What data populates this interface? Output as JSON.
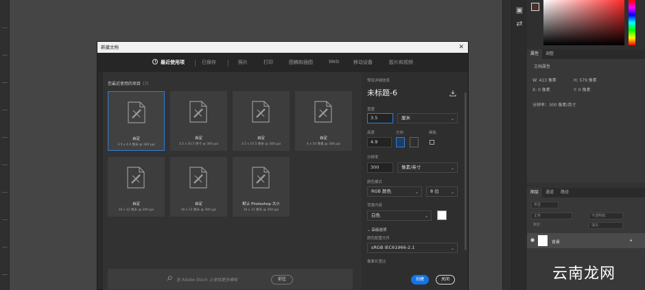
{
  "dialog": {
    "title": "新建文档",
    "tabs": [
      {
        "label": "最近使用项",
        "active": true
      },
      {
        "label": "已保存"
      },
      {
        "label": "照片"
      },
      {
        "label": "打印"
      },
      {
        "label": "图稿和插图"
      },
      {
        "label": "Web"
      },
      {
        "label": "移动设备"
      },
      {
        "label": "胶片和视频"
      }
    ],
    "recent": {
      "heading": "您最近使用的项目",
      "count": "(7)",
      "items": [
        {
          "name": "自定",
          "size": "3.5 x 4.9 厘米 @ 300 ppi"
        },
        {
          "name": "自定",
          "size": "3.5 x 10.5 英寸 @ 300 ppi"
        },
        {
          "name": "自定",
          "size": "3.5 x 10.5 厘米 @ 300 ppi"
        },
        {
          "name": "自定",
          "size": "4 x 10 像素 @ 300 ppi"
        },
        {
          "name": "自定",
          "size": "16 x 12 厘米 @ 300 ppi"
        },
        {
          "name": "自定",
          "size": "16 x 12 厘米 @ 300 ppi"
        },
        {
          "name": "默认 Photoshop 大小",
          "size": "16 x 12 厘米 @ 300 ppi"
        }
      ]
    },
    "search": {
      "placeholder": "在 Adobe Stock 上查找更多模板",
      "go": "前往"
    },
    "details": {
      "section": "预设详细信息",
      "doc_name": "未标题-6",
      "width_label": "宽度",
      "width_value": "3.5",
      "width_unit": "厘米",
      "height_label": "高度",
      "height_value": "4.9",
      "orientation_label": "方向",
      "artboard_label": "画板",
      "resolution_label": "分辨率",
      "resolution_value": "300",
      "resolution_unit": "像素/英寸",
      "color_mode_label": "颜色模式",
      "color_mode_value": "RGB 颜色",
      "bit_depth": "8 位",
      "bg_label": "背景内容",
      "bg_value": "白色",
      "advanced_label": "高级选项",
      "profile_label": "颜色配置文件",
      "profile_value": "sRGB IEC61966-2.1",
      "pixel_aspect_label": "像素长宽比",
      "create_button": "创建",
      "close_button": "关闭"
    }
  },
  "properties_panel": {
    "tabs": [
      "属性",
      "调整"
    ],
    "doc_props": "文档属性",
    "w": "W: 413 像素",
    "h": "H: 579 像素",
    "x": "X: 0 像素",
    "y": "Y: 0 像素",
    "resolution": "分辨率：300 像素/英寸"
  },
  "layers_panel": {
    "tabs": [
      "图层",
      "通道",
      "路径"
    ],
    "kind": "类型",
    "blend": "正常",
    "opacity": "不透明度：",
    "lock": "锁定：",
    "fill": "填充：",
    "layer_name": "背景"
  },
  "watermark": "云南龙网",
  "colors": {
    "accent": "#1473e6",
    "selected_border": "#2f7fd9"
  }
}
